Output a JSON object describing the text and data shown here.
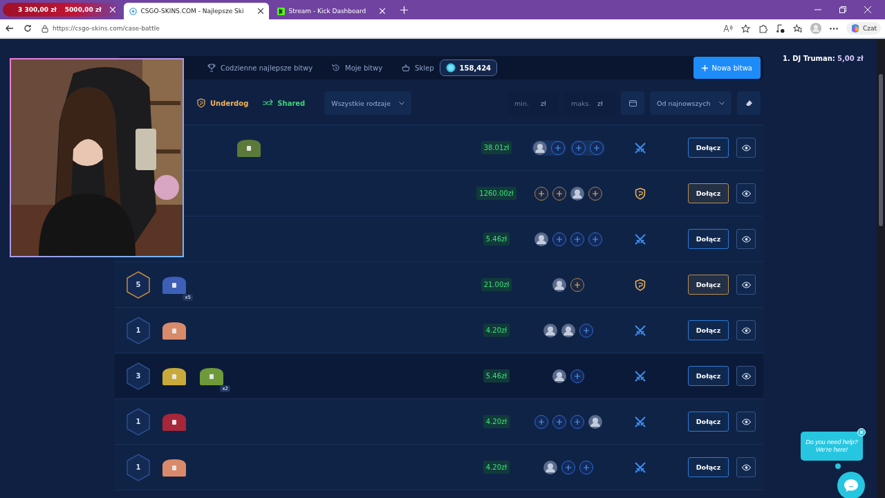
{
  "browser": {
    "tabs": [
      {
        "title": "3 300,00 zł",
        "title_2": "5000,00 zł",
        "kind": "overlay",
        "selected": false
      },
      {
        "title": "CSGO-SKINS.COM - Najlepsze Ski",
        "kind": "site",
        "selected": true
      },
      {
        "title": "Stream - Kick Dashboard",
        "kind": "kick",
        "selected": false
      }
    ],
    "url": "https://csgo-skins.com/case-battle",
    "copilot_label": "Czat"
  },
  "nav": {
    "items": [
      {
        "label": "Codzienne najlepsze bitwy",
        "kind": "daily"
      },
      {
        "label": "Moje bitwy",
        "kind": "mine"
      },
      {
        "label": "Sklep",
        "kind": "shop"
      }
    ],
    "coins": "158,424",
    "new_battle": "Nowa bitwa"
  },
  "filters": {
    "modes": [
      {
        "label": "Underdog",
        "kind": "underdog"
      },
      {
        "label": "Shared",
        "kind": "shared"
      }
    ],
    "type_dropdown": "Wszystkie rodzaje",
    "min": {
      "placeholder": "min.",
      "unit": "zł"
    },
    "max": {
      "placeholder": "maks.",
      "unit": "zł"
    },
    "sort_dropdown": "Od najnowszych"
  },
  "battles": [
    {
      "kind": "standard",
      "highlighted": false,
      "cases": [
        {
          "kind": "hidden"
        },
        {
          "color": "#5b7a3a"
        }
      ],
      "price": "38.01zł",
      "teams": [
        [
          {
            "kind": "avatar"
          },
          {
            "kind": "empty"
          }
        ],
        [
          {
            "kind": "empty"
          },
          {
            "kind": "empty"
          }
        ]
      ],
      "join": "Dołącz"
    },
    {
      "kind": "underdog",
      "highlighted": false,
      "price": "1260.00zł",
      "teams": [
        [
          {
            "kind": "empty"
          },
          {
            "kind": "empty"
          },
          {
            "kind": "avatar"
          },
          {
            "kind": "empty"
          }
        ]
      ],
      "join": "Dołącz"
    },
    {
      "kind": "standard",
      "highlighted": false,
      "price": "5.46zł",
      "teams": [
        [
          {
            "kind": "avatar"
          },
          {
            "kind": "empty"
          },
          {
            "kind": "empty"
          },
          {
            "kind": "empty"
          }
        ]
      ],
      "join": "Dołącz"
    },
    {
      "kind": "underdog",
      "highlighted": false,
      "rounds": "5",
      "cases": [
        {
          "color": "#3d5fb8",
          "multiplier": "x5"
        }
      ],
      "price": "21.00zł",
      "teams": [
        [
          {
            "kind": "avatar"
          },
          {
            "kind": "empty"
          }
        ]
      ],
      "join": "Dołącz"
    },
    {
      "kind": "standard",
      "highlighted": false,
      "rounds": "1",
      "cases": [
        {
          "color": "#d98a6a"
        }
      ],
      "price": "4.20zł",
      "teams": [
        [
          {
            "kind": "avatar"
          },
          {
            "kind": "avatar"
          },
          {
            "kind": "empty"
          }
        ]
      ],
      "join": "Dołącz"
    },
    {
      "kind": "standard",
      "highlighted": true,
      "rounds": "3",
      "cases": [
        {
          "color": "#c9a93a"
        },
        {
          "color": "#6f9a3a",
          "multiplier": "x2"
        }
      ],
      "price": "5.46zł",
      "teams": [
        [
          {
            "kind": "avatar"
          },
          {
            "kind": "empty"
          }
        ]
      ],
      "join": "Dołącz"
    },
    {
      "kind": "standard",
      "highlighted": false,
      "rounds": "1",
      "cases": [
        {
          "color": "#a8263a"
        }
      ],
      "price": "4.20zł",
      "teams": [
        [
          {
            "kind": "empty"
          },
          {
            "kind": "empty"
          },
          {
            "kind": "empty"
          },
          {
            "kind": "avatar"
          }
        ]
      ],
      "join": "Dołącz"
    },
    {
      "kind": "standard",
      "highlighted": false,
      "rounds": "1",
      "cases": [
        {
          "color": "#d98a6a"
        }
      ],
      "price": "4.20zł",
      "teams": [
        [
          {
            "kind": "avatar"
          },
          {
            "kind": "empty"
          },
          {
            "kind": "empty"
          }
        ]
      ],
      "join": "Dołącz"
    }
  ],
  "leaderboard": {
    "rank": "1.",
    "name": "DJ Truman:",
    "amount": "5,00 zł"
  },
  "help": {
    "line_1": "Do you need help?",
    "line_2": "We're here!"
  }
}
